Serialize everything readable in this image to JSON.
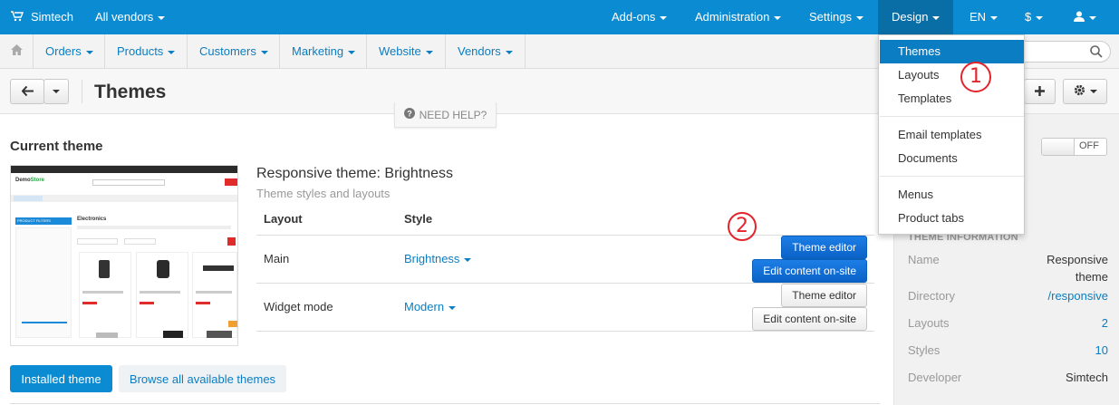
{
  "topbar": {
    "brand": "Simtech",
    "vendor_selector": "All vendors",
    "menu": [
      "Add-ons",
      "Administration",
      "Settings",
      "Design",
      "EN",
      "$"
    ],
    "accent": "#0b8bd1"
  },
  "mainnav": {
    "items": [
      "Orders",
      "Products",
      "Customers",
      "Marketing",
      "Website",
      "Vendors"
    ]
  },
  "toolbar": {
    "title": "Themes",
    "need_help": "NEED HELP?"
  },
  "content": {
    "section_title": "Current theme",
    "theme_name": "Responsive theme: Brightness",
    "theme_sub": "Theme styles and layouts",
    "table": {
      "headers": [
        "Layout",
        "Style"
      ],
      "rows": [
        {
          "layout": "Main",
          "style": "Brightness",
          "btn_editor": "Theme editor",
          "btn_edit": "Edit content on-site"
        },
        {
          "layout": "Widget mode",
          "style": "Modern",
          "btn_editor": "Theme editor",
          "btn_edit": "Edit content on-site"
        }
      ]
    },
    "installed_btn": "Installed theme",
    "browse_btn": "Browse all available themes"
  },
  "thumbnail": {
    "logo_a": "Demo",
    "logo_b": "Store",
    "heading": "Electronics",
    "filters_title": "PRODUCT FILTERS"
  },
  "sidebar": {
    "toggle_label": "OFF",
    "heading": "THEME INFORMATION",
    "rows": [
      {
        "label": "Name",
        "value": "Responsive theme"
      },
      {
        "label": "Directory",
        "value": "/responsive"
      },
      {
        "label": "Layouts",
        "value": "2"
      },
      {
        "label": "Styles",
        "value": "10"
      },
      {
        "label": "Developer",
        "value": "Simtech"
      }
    ]
  },
  "dropdown": {
    "group1": [
      "Themes",
      "Layouts",
      "Templates"
    ],
    "group2": [
      "Email templates",
      "Documents"
    ],
    "group3": [
      "Menus",
      "Product tabs"
    ]
  },
  "annotations": [
    "1",
    "2"
  ]
}
